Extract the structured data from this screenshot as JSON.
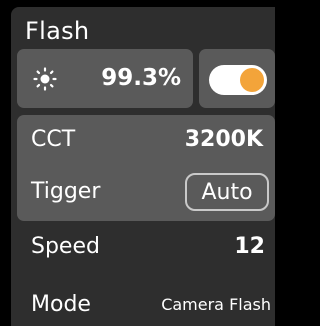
{
  "title": "Flash",
  "brightness": {
    "icon": "sun-icon",
    "value": "99.3%"
  },
  "flash_toggle": {
    "on": true,
    "track_color": "#ffffff",
    "knob_color": "#f3a43a"
  },
  "cct": {
    "label": "CCT",
    "value": "3200K"
  },
  "trigger": {
    "label": "Tigger",
    "value": "Auto"
  },
  "speed": {
    "label": "Speed",
    "value": "12"
  },
  "mode": {
    "label": "Mode",
    "value": "Camera Flash"
  },
  "colors": {
    "background": "#2e2e2e",
    "card": "#5a5a5a",
    "accent": "#f3a43a"
  }
}
